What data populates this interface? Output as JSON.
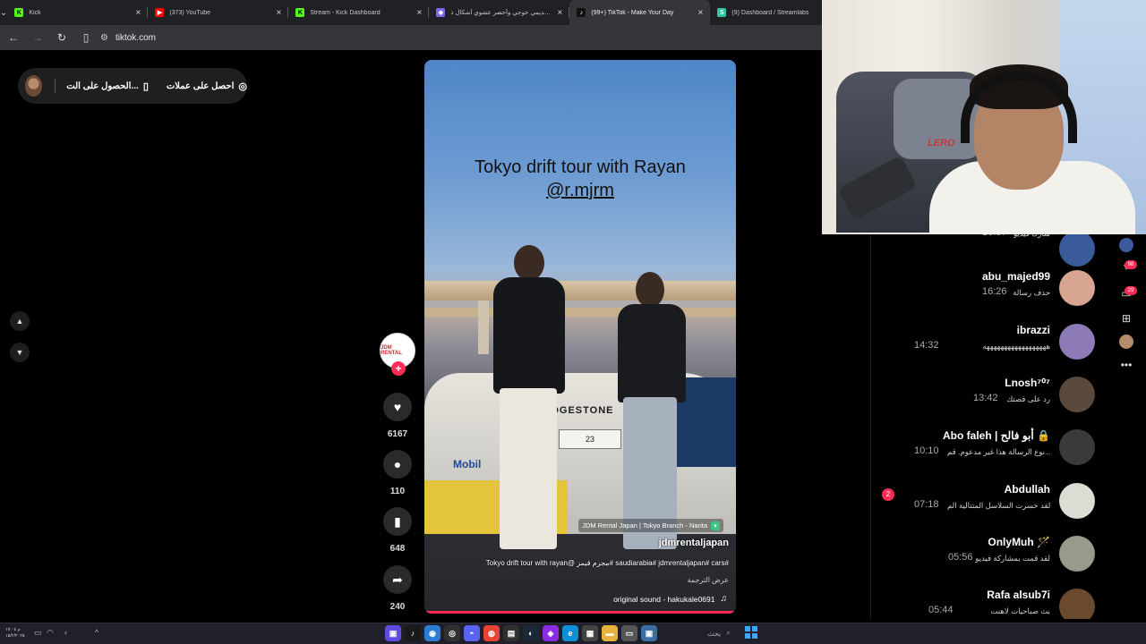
{
  "browser": {
    "tabs": [
      {
        "title": "Kick",
        "icon": "kick-icon",
        "color": "#53fc18",
        "glyph": "K",
        "active": false
      },
      {
        "title": "(373) YouTube",
        "icon": "youtube-icon",
        "color": "#ff0000",
        "glyph": "▶",
        "active": false
      },
      {
        "title": "Stream - Kick Dashboard",
        "icon": "kick-icon",
        "color": "#53fc18",
        "glyph": "K",
        "active": false
      },
      {
        "title": "عرض تقديمي خوجي وأحضر عشوي أشكال ذ",
        "icon": "shield-icon",
        "color": "#7b68ee",
        "glyph": "◆",
        "active": false
      },
      {
        "title": "(99+) TikTok - Make Your Day",
        "icon": "tiktok-icon",
        "color": "#111111",
        "glyph": "♪",
        "active": true
      },
      {
        "title": "(9) Dashboard / Streamlabs",
        "icon": "streamlabs-icon",
        "color": "#31c3a2",
        "glyph": "S",
        "active": false
      }
    ],
    "url": "tiktok.com"
  },
  "page": {
    "coins_label": "احصل على عملات",
    "get_app_label": "الحصول على الت..."
  },
  "video": {
    "title_line1": "Tokyo drift tour with Rayan",
    "title_handle": "@r.mjrm",
    "location": "JDM Rental Japan | Tokyo Branch - Narita",
    "author": "jdmrentaljapan",
    "caption": "Tokyo drift tour with rayan@ مجرم قيمز# saudiarabia# jdmrentaljapan# cars#",
    "translate_label": "عرض الترجمة",
    "sound": "original sound - hakukale0691",
    "plate": "23",
    "sponsor": "BRIDGESTONE",
    "mobil": "Mobil",
    "brand_short": "JDM RENTAL",
    "progress": 0.99
  },
  "actions": {
    "likes": "6167",
    "comments": "110",
    "saves": "648",
    "shares": "240"
  },
  "webcam": {
    "chair_brand": "LERO"
  },
  "messages": [
    {
      "name": "",
      "preview": "شارك فيديو",
      "time": "16:57",
      "color": "#3a5a9c",
      "badge": ""
    },
    {
      "name": "abu_majed99",
      "preview": "حذف رسالة",
      "time": "16:26",
      "color": "#d8a592",
      "badge": ""
    },
    {
      "name": "ibrazzi",
      "preview": "ههههههههههههههههههه",
      "time": "14:32",
      "color": "#8d7bb8",
      "badge": ""
    },
    {
      "name": "Lnosh⁷⁰⁷",
      "preview": "رد على قصتك",
      "time": "13:42",
      "color": "#5a4a3e",
      "badge": ""
    },
    {
      "name": "Abo faleh | أبو فالح 🔒",
      "preview": "نوع الرسالة هذا غير مدعوم. قم...",
      "time": "10:10",
      "color": "#3a3a3a",
      "badge": ""
    },
    {
      "name": "Abdullah",
      "preview": "لقد خسرت السلاسل المتتالية الم...",
      "time": "07:18",
      "color": "#dcdcd4",
      "badge": "2"
    },
    {
      "name": "OnlyMuh 🪄",
      "preview": "لقد قمت بمشاركة فيديو",
      "time": "05:56",
      "color": "#9a9a8a",
      "badge": ""
    },
    {
      "name": "Rafa alsub7i",
      "preview": "بث صباحيات لاهنت",
      "time": "05:44",
      "color": "#6a4a2e",
      "badge": ""
    }
  ],
  "rail": {
    "badge1": "98",
    "badge2": "29"
  },
  "taskbar": {
    "clock_time": "م ١٧:٠٤",
    "clock_date": "١٥/٢/٢٠٢٥",
    "search_label": "بحث",
    "apps": [
      {
        "icon": "file-explorer-icon",
        "color": "#5e4de0",
        "glyph": "▣"
      },
      {
        "icon": "tiktok-icon",
        "color": "#1a1a1a",
        "glyph": "♪"
      },
      {
        "icon": "chat-icon",
        "color": "#2b7cd3",
        "glyph": "◉"
      },
      {
        "icon": "obs-icon",
        "color": "#303030",
        "glyph": "◎"
      },
      {
        "icon": "discord-icon",
        "color": "#5865f2",
        "glyph": "◓"
      },
      {
        "icon": "chrome-icon",
        "color": "#e94235",
        "glyph": "◍"
      },
      {
        "icon": "capture-icon",
        "color": "#303030",
        "glyph": "▤"
      },
      {
        "icon": "steam-icon",
        "color": "#1b2838",
        "glyph": "◐"
      },
      {
        "icon": "game-icon",
        "color": "#8b2be2",
        "glyph": "◈"
      },
      {
        "icon": "edge-icon",
        "color": "#0f8fd8",
        "glyph": "e"
      },
      {
        "icon": "grid-app-icon",
        "color": "#444444",
        "glyph": "▦"
      },
      {
        "icon": "folder-icon",
        "color": "#e8b33a",
        "glyph": "▬"
      },
      {
        "icon": "notepad-icon",
        "color": "#555555",
        "glyph": "▭"
      },
      {
        "icon": "screen-icon",
        "color": "#3a6ea5",
        "glyph": "▣"
      }
    ]
  }
}
